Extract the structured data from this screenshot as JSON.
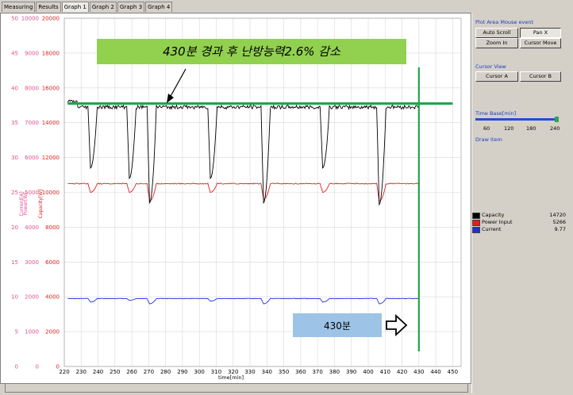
{
  "tabs": [
    "Measuring",
    "Results",
    "Graph 1",
    "Graph 2",
    "Graph 3",
    "Graph 4"
  ],
  "active_tab": "Graph 1",
  "panel": {
    "mouse_event_title": "Plot Area Mouse event",
    "auto_scroll": "Auto Scroll",
    "pan_x": "Pan X",
    "zoom_in": "Zoom In",
    "cursor_move": "Cursor Move",
    "cursor_view_title": "Cursor View",
    "cursor_a": "Cursor A",
    "cursor_b": "Cursor B",
    "time_base_title": "Time Base[min]",
    "time_base_ticks": [
      "60",
      "120",
      "180",
      "240"
    ],
    "time_base_value": 240,
    "draw_item_title": "Draw Item"
  },
  "legend": [
    {
      "name": "Capacity",
      "value": "14720",
      "color": "#000000"
    },
    {
      "name": "Power Input",
      "value": "5266",
      "color": "#e02020"
    },
    {
      "name": "Current",
      "value": "9.77",
      "color": "#2030e0"
    }
  ],
  "annotations": {
    "banner": "430분 경과 후 난방능력2.6% 감소",
    "box": "430분"
  },
  "chart_data": {
    "type": "line",
    "xlabel": "time[min]",
    "xlim": [
      220,
      455
    ],
    "x_ticks": [
      220,
      230,
      240,
      250,
      260,
      270,
      280,
      290,
      300,
      310,
      320,
      330,
      340,
      350,
      360,
      370,
      380,
      390,
      400,
      410,
      420,
      430,
      440,
      450
    ],
    "y_axes": [
      {
        "label": "Current[A]",
        "color": "#e0508c",
        "ticks": [
          0,
          5,
          10,
          15,
          20,
          25,
          30,
          35,
          40,
          45,
          50
        ]
      },
      {
        "label": "Power[W]",
        "color": "#e0508c",
        "ticks": [
          0,
          1000,
          2000,
          3000,
          4000,
          5000,
          6000,
          7000,
          8000,
          9000,
          10000
        ]
      },
      {
        "label": "Capacity[W]",
        "color": "#e02020",
        "ticks": [
          0,
          2000,
          4000,
          6000,
          8000,
          10000,
          12000,
          14000,
          16000,
          18000,
          20000
        ]
      }
    ],
    "ylim_capacity": [
      0,
      20000
    ],
    "series": [
      {
        "name": "Capacity",
        "color": "#000000",
        "baseline": 14900,
        "dips": [
          [
            235.5,
            11400
          ],
          [
            270.5,
            9400
          ],
          [
            258.5,
            10800
          ],
          [
            306.5,
            10800
          ],
          [
            338,
            9400
          ],
          [
            373,
            11400
          ],
          [
            406.5,
            9300
          ]
        ]
      },
      {
        "name": "Power Input",
        "color": "#e02020",
        "baseline": 10500,
        "dips": [
          [
            235.5,
            10000
          ],
          [
            270.5,
            9500
          ],
          [
            258.5,
            10000
          ],
          [
            306.5,
            10000
          ],
          [
            338,
            9600
          ],
          [
            373,
            10000
          ],
          [
            406.5,
            9500
          ]
        ]
      },
      {
        "name": "Current",
        "color": "#2030e0",
        "baseline": 3900,
        "dips": [
          [
            235.5,
            3700
          ],
          [
            270.5,
            3600
          ],
          [
            258.5,
            3800
          ],
          [
            306.5,
            3750
          ],
          [
            338,
            3600
          ],
          [
            373,
            3700
          ],
          [
            406.5,
            3600
          ]
        ]
      }
    ],
    "x_end": 430,
    "reference_line_capacity": 15100,
    "marker_x": 430,
    "grid": true
  }
}
